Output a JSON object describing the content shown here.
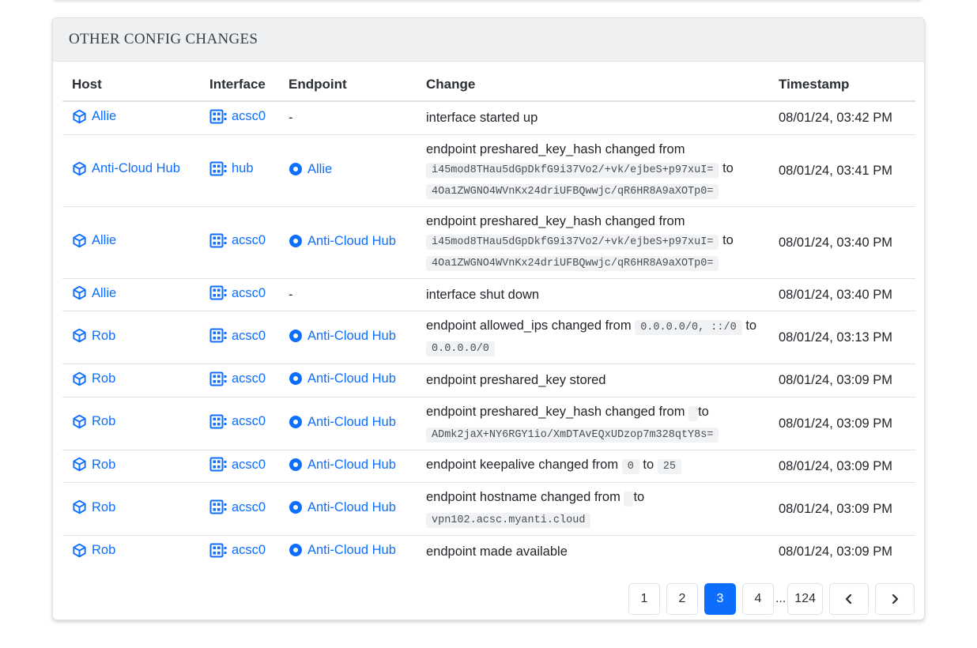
{
  "card": {
    "title": "OTHER CONFIG CHANGES"
  },
  "columns": {
    "host": "Host",
    "interface": "Interface",
    "endpoint": "Endpoint",
    "change": "Change",
    "timestamp": "Timestamp"
  },
  "rows": [
    {
      "host": "Allie",
      "interface": "acsc0",
      "endpoint": "",
      "endpoint_dash": "-",
      "change": {
        "prefix": "interface started up"
      },
      "timestamp": "08/01/24, 03:42 PM"
    },
    {
      "host": "Anti-Cloud Hub",
      "interface": "hub",
      "endpoint": "Allie",
      "change": {
        "prefix": "endpoint preshared_key_hash changed from",
        "from": "i45mod8THau5dGpDkfG9i37Vo2/+vk/ejbeS+p97xuI=",
        "mid": "to",
        "to": "4Oa1ZWGNO4WVnKx24driUFBQwwjc/qR6HR8A9aXOTp0="
      },
      "timestamp": "08/01/24, 03:41 PM"
    },
    {
      "host": "Allie",
      "interface": "acsc0",
      "endpoint": "Anti-Cloud Hub",
      "change": {
        "prefix": "endpoint preshared_key_hash changed from",
        "from": "i45mod8THau5dGpDkfG9i37Vo2/+vk/ejbeS+p97xuI=",
        "mid": "to",
        "to": "4Oa1ZWGNO4WVnKx24driUFBQwwjc/qR6HR8A9aXOTp0="
      },
      "timestamp": "08/01/24, 03:40 PM"
    },
    {
      "host": "Allie",
      "interface": "acsc0",
      "endpoint": "",
      "endpoint_dash": "-",
      "change": {
        "prefix": "interface shut down"
      },
      "timestamp": "08/01/24, 03:40 PM"
    },
    {
      "host": "Rob",
      "interface": "acsc0",
      "endpoint": "Anti-Cloud Hub",
      "change": {
        "prefix": "endpoint allowed_ips changed from",
        "from": "0.0.0.0/0, ::/0",
        "mid": "to",
        "to": "0.0.0.0/0"
      },
      "timestamp": "08/01/24, 03:13 PM"
    },
    {
      "host": "Rob",
      "interface": "acsc0",
      "endpoint": "Anti-Cloud Hub",
      "change": {
        "prefix": "endpoint preshared_key stored"
      },
      "timestamp": "08/01/24, 03:09 PM"
    },
    {
      "host": "Rob",
      "interface": "acsc0",
      "endpoint": "Anti-Cloud Hub",
      "change": {
        "prefix": "endpoint preshared_key_hash changed from",
        "from": "",
        "mid": "to",
        "to": "ADmk2jaX+NY6RGY1io/XmDTAvEQxUDzop7m328qtY8s="
      },
      "timestamp": "08/01/24, 03:09 PM"
    },
    {
      "host": "Rob",
      "interface": "acsc0",
      "endpoint": "Anti-Cloud Hub",
      "change": {
        "prefix": "endpoint keepalive changed from",
        "from": "0",
        "mid": "to",
        "to": "25"
      },
      "timestamp": "08/01/24, 03:09 PM"
    },
    {
      "host": "Rob",
      "interface": "acsc0",
      "endpoint": "Anti-Cloud Hub",
      "change": {
        "prefix": "endpoint hostname changed from",
        "from": "",
        "mid": "to",
        "to": "vpn102.acsc.myanti.cloud"
      },
      "timestamp": "08/01/24, 03:09 PM"
    },
    {
      "host": "Rob",
      "interface": "acsc0",
      "endpoint": "Anti-Cloud Hub",
      "change": {
        "prefix": "endpoint made available"
      },
      "timestamp": "08/01/24, 03:09 PM"
    }
  ],
  "pagination": {
    "pages": [
      "1",
      "2",
      "3",
      "4"
    ],
    "ellipsis": "...",
    "last": "124",
    "current": "3",
    "prev_icon": "chevron-left-icon",
    "next_icon": "chevron-right-icon"
  },
  "icons": {
    "host": "cube-icon",
    "interface": "network-interface-icon",
    "endpoint": "endpoint-dot-icon"
  },
  "colors": {
    "link": "#0d6efd",
    "active_page": "#0d6efd",
    "header_bg": "#eef0f2"
  }
}
